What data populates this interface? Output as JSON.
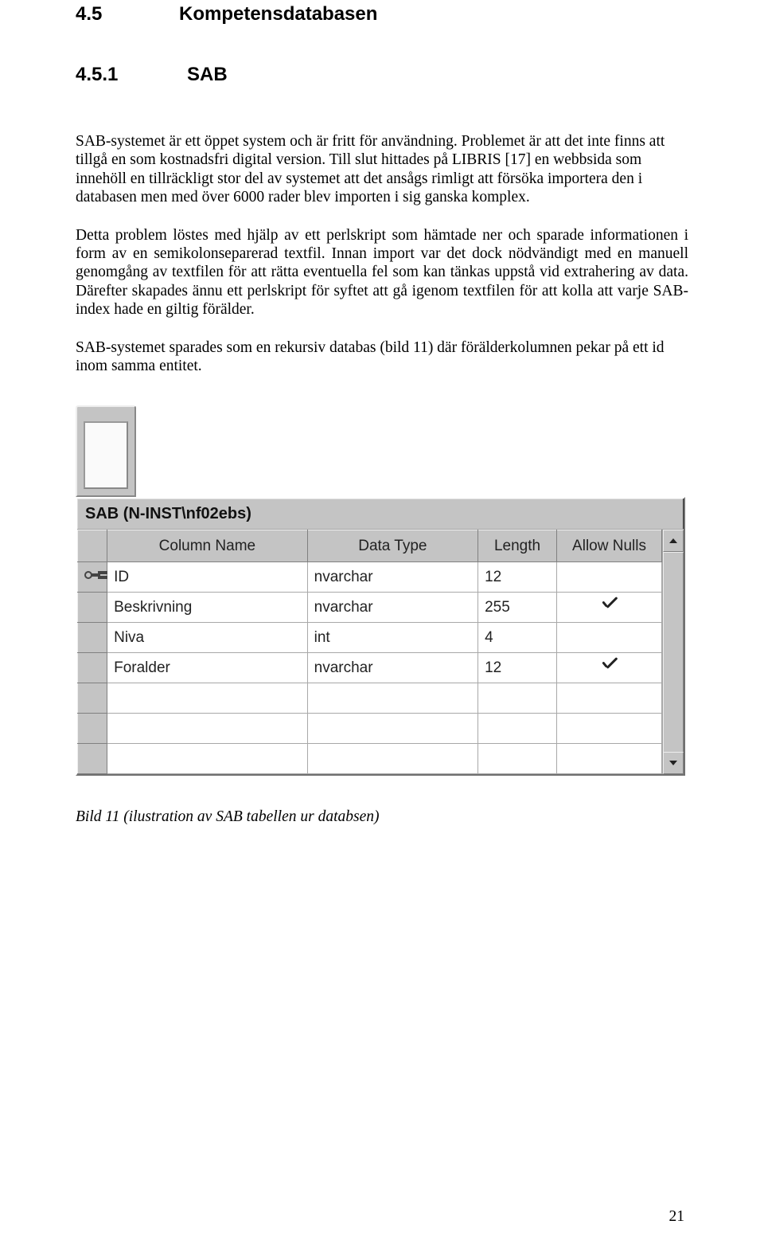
{
  "headings": {
    "section_num": "4.5",
    "section_title": "Kompetensdatabasen",
    "sub_num": "4.5.1",
    "sub_title": "SAB"
  },
  "paragraphs": {
    "p1": "SAB-systemet är ett öppet system och är fritt för användning. Problemet är att det inte finns att tillgå en som kostnadsfri digital version. Till slut hittades på LIBRIS [17] en webbsida som innehöll en tillräckligt stor del av systemet att det ansågs rimligt att försöka importera den i databasen men med över 6000 rader blev importen i sig ganska komplex.",
    "p2": "Detta problem löstes med hjälp av ett perlskript som hämtade ner och sparade informationen i form av en semikolonseparerad textfil. Innan import var det dock nödvändigt med en manuell genomgång av textfilen för att rätta eventuella fel som kan tänkas uppstå vid extrahering av data. Därefter skapades ännu ett perlskript för syftet att gå igenom textfilen för att kolla att varje SAB-index hade en giltig förälder.",
    "p3": "SAB-systemet sparades som en rekursiv databas (bild 11) där förälderkolumnen pekar på ett id inom samma entitet."
  },
  "db_panel": {
    "title": "SAB (N-INST\\nf02ebs)",
    "headers": {
      "col_name": "Column Name",
      "data_type": "Data Type",
      "length": "Length",
      "allow_nulls": "Allow Nulls"
    },
    "rows": [
      {
        "pk": true,
        "name": "ID",
        "type": "nvarchar",
        "length": "12",
        "nulls": false
      },
      {
        "pk": false,
        "name": "Beskrivning",
        "type": "nvarchar",
        "length": "255",
        "nulls": true
      },
      {
        "pk": false,
        "name": "Niva",
        "type": "int",
        "length": "4",
        "nulls": false
      },
      {
        "pk": false,
        "name": "Foralder",
        "type": "nvarchar",
        "length": "12",
        "nulls": true
      }
    ]
  },
  "caption": "Bild 11 (ilustration av SAB tabellen ur databsen)",
  "page_number": "21"
}
